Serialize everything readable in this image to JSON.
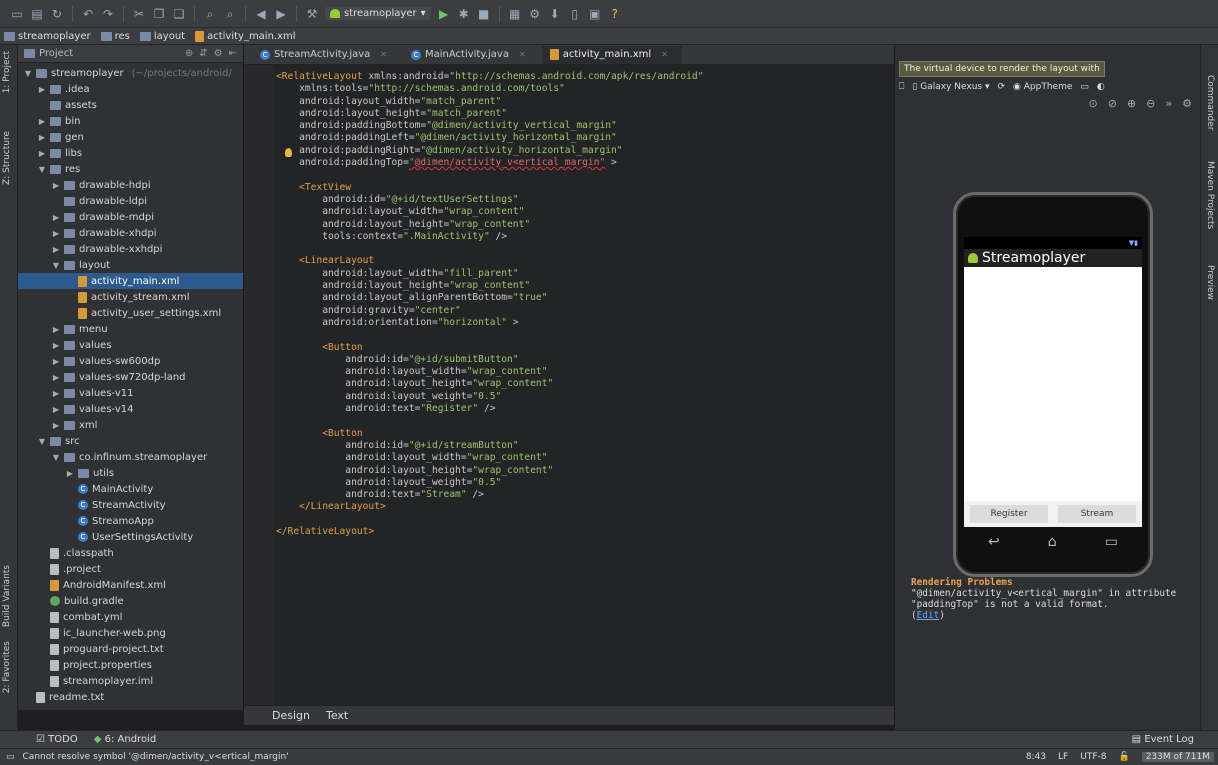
{
  "toolbar": {
    "run_config": "streamoplayer"
  },
  "breadcrumbs": [
    "streamoplayer",
    "res",
    "layout",
    "activity_main.xml"
  ],
  "project_panel": {
    "header": "Project",
    "tree": [
      {
        "label": "streamoplayer",
        "extra": "(~/projects/android/",
        "indent": 0,
        "arrow": "▼",
        "icon": "folder"
      },
      {
        "label": ".idea",
        "indent": 1,
        "arrow": "▶",
        "icon": "folder"
      },
      {
        "label": "assets",
        "indent": 1,
        "arrow": "",
        "icon": "folder"
      },
      {
        "label": "bin",
        "indent": 1,
        "arrow": "▶",
        "icon": "folder"
      },
      {
        "label": "gen",
        "indent": 1,
        "arrow": "▶",
        "icon": "folder"
      },
      {
        "label": "libs",
        "indent": 1,
        "arrow": "▶",
        "icon": "folder"
      },
      {
        "label": "res",
        "indent": 1,
        "arrow": "▼",
        "icon": "folder"
      },
      {
        "label": "drawable-hdpi",
        "indent": 2,
        "arrow": "▶",
        "icon": "folder"
      },
      {
        "label": "drawable-ldpi",
        "indent": 2,
        "arrow": "",
        "icon": "folder"
      },
      {
        "label": "drawable-mdpi",
        "indent": 2,
        "arrow": "▶",
        "icon": "folder"
      },
      {
        "label": "drawable-xhdpi",
        "indent": 2,
        "arrow": "▶",
        "icon": "folder"
      },
      {
        "label": "drawable-xxhdpi",
        "indent": 2,
        "arrow": "▶",
        "icon": "folder"
      },
      {
        "label": "layout",
        "indent": 2,
        "arrow": "▼",
        "icon": "folder"
      },
      {
        "label": "activity_main.xml",
        "indent": 3,
        "arrow": "",
        "icon": "xml",
        "selected": true
      },
      {
        "label": "activity_stream.xml",
        "indent": 3,
        "arrow": "",
        "icon": "xml"
      },
      {
        "label": "activity_user_settings.xml",
        "indent": 3,
        "arrow": "",
        "icon": "xml"
      },
      {
        "label": "menu",
        "indent": 2,
        "arrow": "▶",
        "icon": "folder"
      },
      {
        "label": "values",
        "indent": 2,
        "arrow": "▶",
        "icon": "folder"
      },
      {
        "label": "values-sw600dp",
        "indent": 2,
        "arrow": "▶",
        "icon": "folder"
      },
      {
        "label": "values-sw720dp-land",
        "indent": 2,
        "arrow": "▶",
        "icon": "folder"
      },
      {
        "label": "values-v11",
        "indent": 2,
        "arrow": "▶",
        "icon": "folder"
      },
      {
        "label": "values-v14",
        "indent": 2,
        "arrow": "▶",
        "icon": "folder"
      },
      {
        "label": "xml",
        "indent": 2,
        "arrow": "▶",
        "icon": "folder"
      },
      {
        "label": "src",
        "indent": 1,
        "arrow": "▼",
        "icon": "folder"
      },
      {
        "label": "co.infinum.streamoplayer",
        "indent": 2,
        "arrow": "▼",
        "icon": "folder"
      },
      {
        "label": "utils",
        "indent": 3,
        "arrow": "▶",
        "icon": "folder"
      },
      {
        "label": "MainActivity",
        "indent": 3,
        "arrow": "",
        "icon": "class"
      },
      {
        "label": "StreamActivity",
        "indent": 3,
        "arrow": "",
        "icon": "class"
      },
      {
        "label": "StreamoApp",
        "indent": 3,
        "arrow": "",
        "icon": "class"
      },
      {
        "label": "UserSettingsActivity",
        "indent": 3,
        "arrow": "",
        "icon": "class"
      },
      {
        "label": ".classpath",
        "indent": 1,
        "arrow": "",
        "icon": "doc"
      },
      {
        "label": ".project",
        "indent": 1,
        "arrow": "",
        "icon": "doc"
      },
      {
        "label": "AndroidManifest.xml",
        "indent": 1,
        "arrow": "",
        "icon": "xml"
      },
      {
        "label": "build.gradle",
        "indent": 1,
        "arrow": "",
        "icon": "gradle"
      },
      {
        "label": "combat.yml",
        "indent": 1,
        "arrow": "",
        "icon": "doc"
      },
      {
        "label": "ic_launcher-web.png",
        "indent": 1,
        "arrow": "",
        "icon": "doc"
      },
      {
        "label": "proguard-project.txt",
        "indent": 1,
        "arrow": "",
        "icon": "doc"
      },
      {
        "label": "project.properties",
        "indent": 1,
        "arrow": "",
        "icon": "doc"
      },
      {
        "label": "streamoplayer.iml",
        "indent": 1,
        "arrow": "",
        "icon": "doc"
      },
      {
        "label": "readme.txt",
        "indent": 0,
        "arrow": "",
        "icon": "doc"
      }
    ]
  },
  "left_strip": [
    "1: Project",
    "Z: Structure",
    "Build Variants",
    "2: Favorites"
  ],
  "right_strip": [
    "Commander",
    "Maven Projects",
    "Preview"
  ],
  "editor_tabs": [
    {
      "label": "StreamActivity.java",
      "icon": "class",
      "active": false
    },
    {
      "label": "MainActivity.java",
      "icon": "class",
      "active": false
    },
    {
      "label": "activity_main.xml",
      "icon": "xml",
      "active": true
    }
  ],
  "code_lines": [
    [
      [
        "tag",
        "<RelativeLayout "
      ],
      [
        "attr",
        "xmlns:android="
      ],
      [
        "val",
        "\"http://schemas.android.com/apk/res/android\""
      ]
    ],
    [
      [
        "attr",
        "    xmlns:tools="
      ],
      [
        "val",
        "\"http://schemas.android.com/tools\""
      ]
    ],
    [
      [
        "attr",
        "    android:layout_width="
      ],
      [
        "val",
        "\"match_parent\""
      ]
    ],
    [
      [
        "attr",
        "    android:layout_height="
      ],
      [
        "val",
        "\"match_parent\""
      ]
    ],
    [
      [
        "attr",
        "    android:paddingBottom="
      ],
      [
        "val",
        "\"@dimen/activity_vertical_margin\""
      ]
    ],
    [
      [
        "attr",
        "    android:paddingLeft="
      ],
      [
        "val",
        "\"@dimen/activity_horizontal_margin\""
      ]
    ],
    [
      [
        "attr",
        "    android:paddingRight="
      ],
      [
        "val",
        "\"@dimen/activity_horizontal_margin\""
      ]
    ],
    [
      [
        "attr",
        "    android:paddingTop="
      ],
      [
        "err",
        "\"@dimen/activity_v<ertical_margin\""
      ],
      [
        "attr",
        " >"
      ]
    ],
    [
      [
        "attr",
        ""
      ]
    ],
    [
      [
        "tag",
        "    <TextView"
      ]
    ],
    [
      [
        "attr",
        "        android:id="
      ],
      [
        "val",
        "\"@+id/textUserSettings\""
      ]
    ],
    [
      [
        "attr",
        "        android:layout_width="
      ],
      [
        "val",
        "\"wrap_content\""
      ]
    ],
    [
      [
        "attr",
        "        android:layout_height="
      ],
      [
        "val",
        "\"wrap_content\""
      ]
    ],
    [
      [
        "attr",
        "        tools:context="
      ],
      [
        "val",
        "\".MainActivity\""
      ],
      [
        "attr",
        " />"
      ]
    ],
    [
      [
        "attr",
        ""
      ]
    ],
    [
      [
        "tag",
        "    <LinearLayout"
      ]
    ],
    [
      [
        "attr",
        "        android:layout_width="
      ],
      [
        "val",
        "\"fill_parent\""
      ]
    ],
    [
      [
        "attr",
        "        android:layout_height="
      ],
      [
        "val",
        "\"wrap_content\""
      ]
    ],
    [
      [
        "attr",
        "        android:layout_alignParentBottom="
      ],
      [
        "val",
        "\"true\""
      ]
    ],
    [
      [
        "attr",
        "        android:gravity="
      ],
      [
        "val",
        "\"center\""
      ]
    ],
    [
      [
        "attr",
        "        android:orientation="
      ],
      [
        "val",
        "\"horizontal\""
      ],
      [
        "attr",
        " >"
      ]
    ],
    [
      [
        "attr",
        ""
      ]
    ],
    [
      [
        "tag",
        "        <Button"
      ]
    ],
    [
      [
        "attr",
        "            android:id="
      ],
      [
        "val",
        "\"@+id/submitButton\""
      ]
    ],
    [
      [
        "attr",
        "            android:layout_width="
      ],
      [
        "val",
        "\"wrap_content\""
      ]
    ],
    [
      [
        "attr",
        "            android:layout_height="
      ],
      [
        "val",
        "\"wrap_content\""
      ]
    ],
    [
      [
        "attr",
        "            android:layout_weight="
      ],
      [
        "val",
        "\"0.5\""
      ]
    ],
    [
      [
        "attr",
        "            android:text="
      ],
      [
        "val",
        "\"Register\""
      ],
      [
        "attr",
        " />"
      ]
    ],
    [
      [
        "attr",
        ""
      ]
    ],
    [
      [
        "tag",
        "        <Button"
      ]
    ],
    [
      [
        "attr",
        "            android:id="
      ],
      [
        "val",
        "\"@+id/streamButton\""
      ]
    ],
    [
      [
        "attr",
        "            android:layout_width="
      ],
      [
        "val",
        "\"wrap_content\""
      ]
    ],
    [
      [
        "attr",
        "            android:layout_height="
      ],
      [
        "val",
        "\"wrap_content\""
      ]
    ],
    [
      [
        "attr",
        "            android:layout_weight="
      ],
      [
        "val",
        "\"0.5\""
      ]
    ],
    [
      [
        "attr",
        "            android:text="
      ],
      [
        "val",
        "\"Stream\""
      ],
      [
        "attr",
        " />"
      ]
    ],
    [
      [
        "tag",
        "    </LinearLayout>"
      ]
    ],
    [
      [
        "attr",
        ""
      ]
    ],
    [
      [
        "tag",
        "</RelativeLayout>"
      ]
    ]
  ],
  "editor_bottom_tabs": [
    "Design",
    "Text"
  ],
  "preview": {
    "tooltip": "The virtual device to render the layout with",
    "device": "Galaxy Nexus",
    "theme": "AppTheme",
    "app_title": "Streamoplayer",
    "buttons": [
      "Register",
      "Stream"
    ],
    "problems_title": "Rendering Problems",
    "problems_text": "\"@dimen/activity_v<ertical_margin\" in attribute \"paddingTop\" is not a valid format.",
    "edit_link": "Edit"
  },
  "tool_windows": {
    "todo": "TODO",
    "android": "6: Android",
    "event_log": "Event Log"
  },
  "status": {
    "message": "Cannot resolve symbol '@dimen/activity_v<ertical_margin'",
    "position": "8:43",
    "line_sep": "LF",
    "encoding": "UTF-8",
    "memory": "233M of 711M"
  }
}
